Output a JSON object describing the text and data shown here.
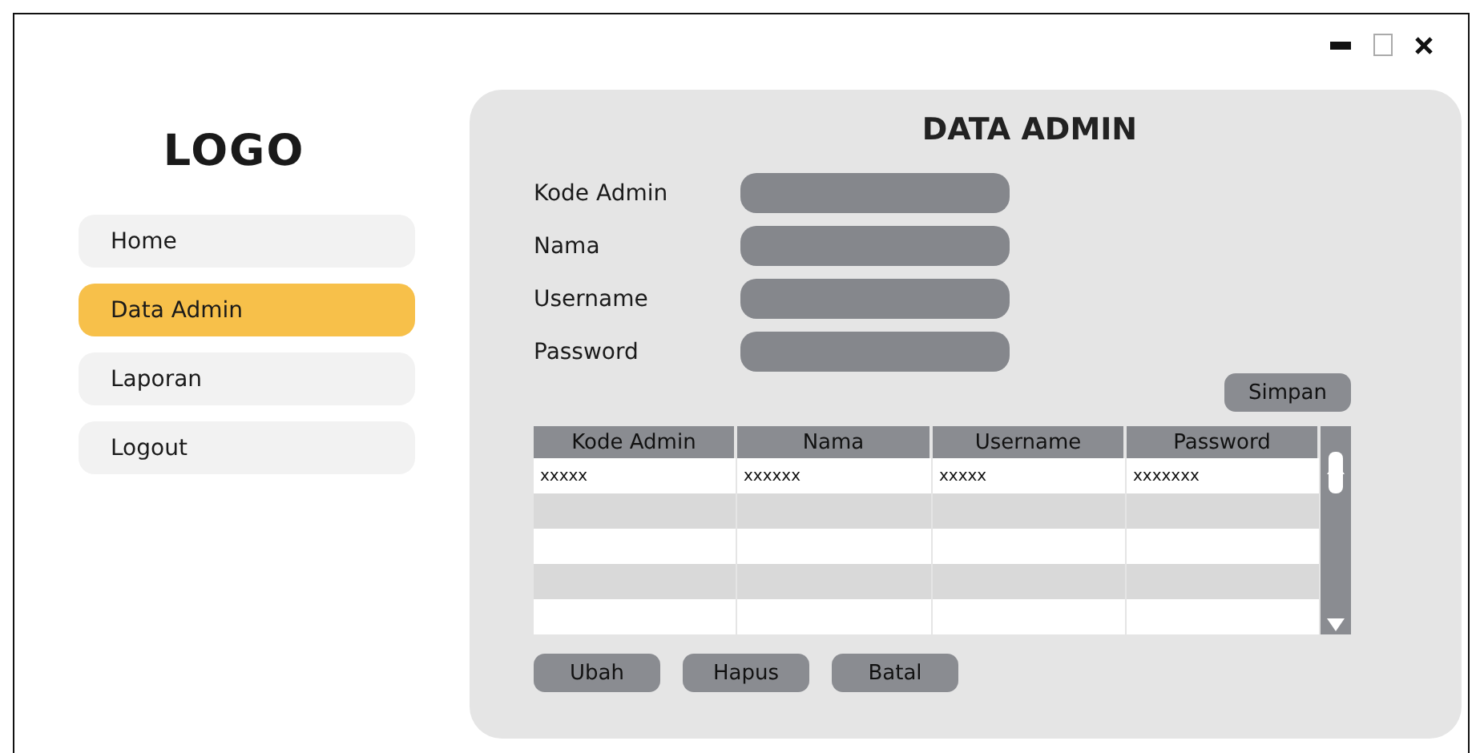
{
  "logo": "LOGO",
  "sidebar": {
    "items": [
      {
        "label": "Home",
        "selected": false
      },
      {
        "label": "Data Admin",
        "selected": true
      },
      {
        "label": "Laporan",
        "selected": false
      },
      {
        "label": "Logout",
        "selected": false
      }
    ]
  },
  "panel": {
    "title": "DATA ADMIN",
    "fields": [
      {
        "label": "Kode Admin"
      },
      {
        "label": "Nama"
      },
      {
        "label": "Username"
      },
      {
        "label": "Password"
      }
    ],
    "save_button": "Simpan",
    "table": {
      "columns": [
        "Kode Admin",
        "Nama",
        "Username",
        "Password"
      ],
      "rows": [
        [
          "xxxxx",
          "xxxxxx",
          "xxxxx",
          "xxxxxxx"
        ]
      ]
    },
    "buttons": [
      "Ubah",
      "Hapus",
      "Batal"
    ]
  }
}
